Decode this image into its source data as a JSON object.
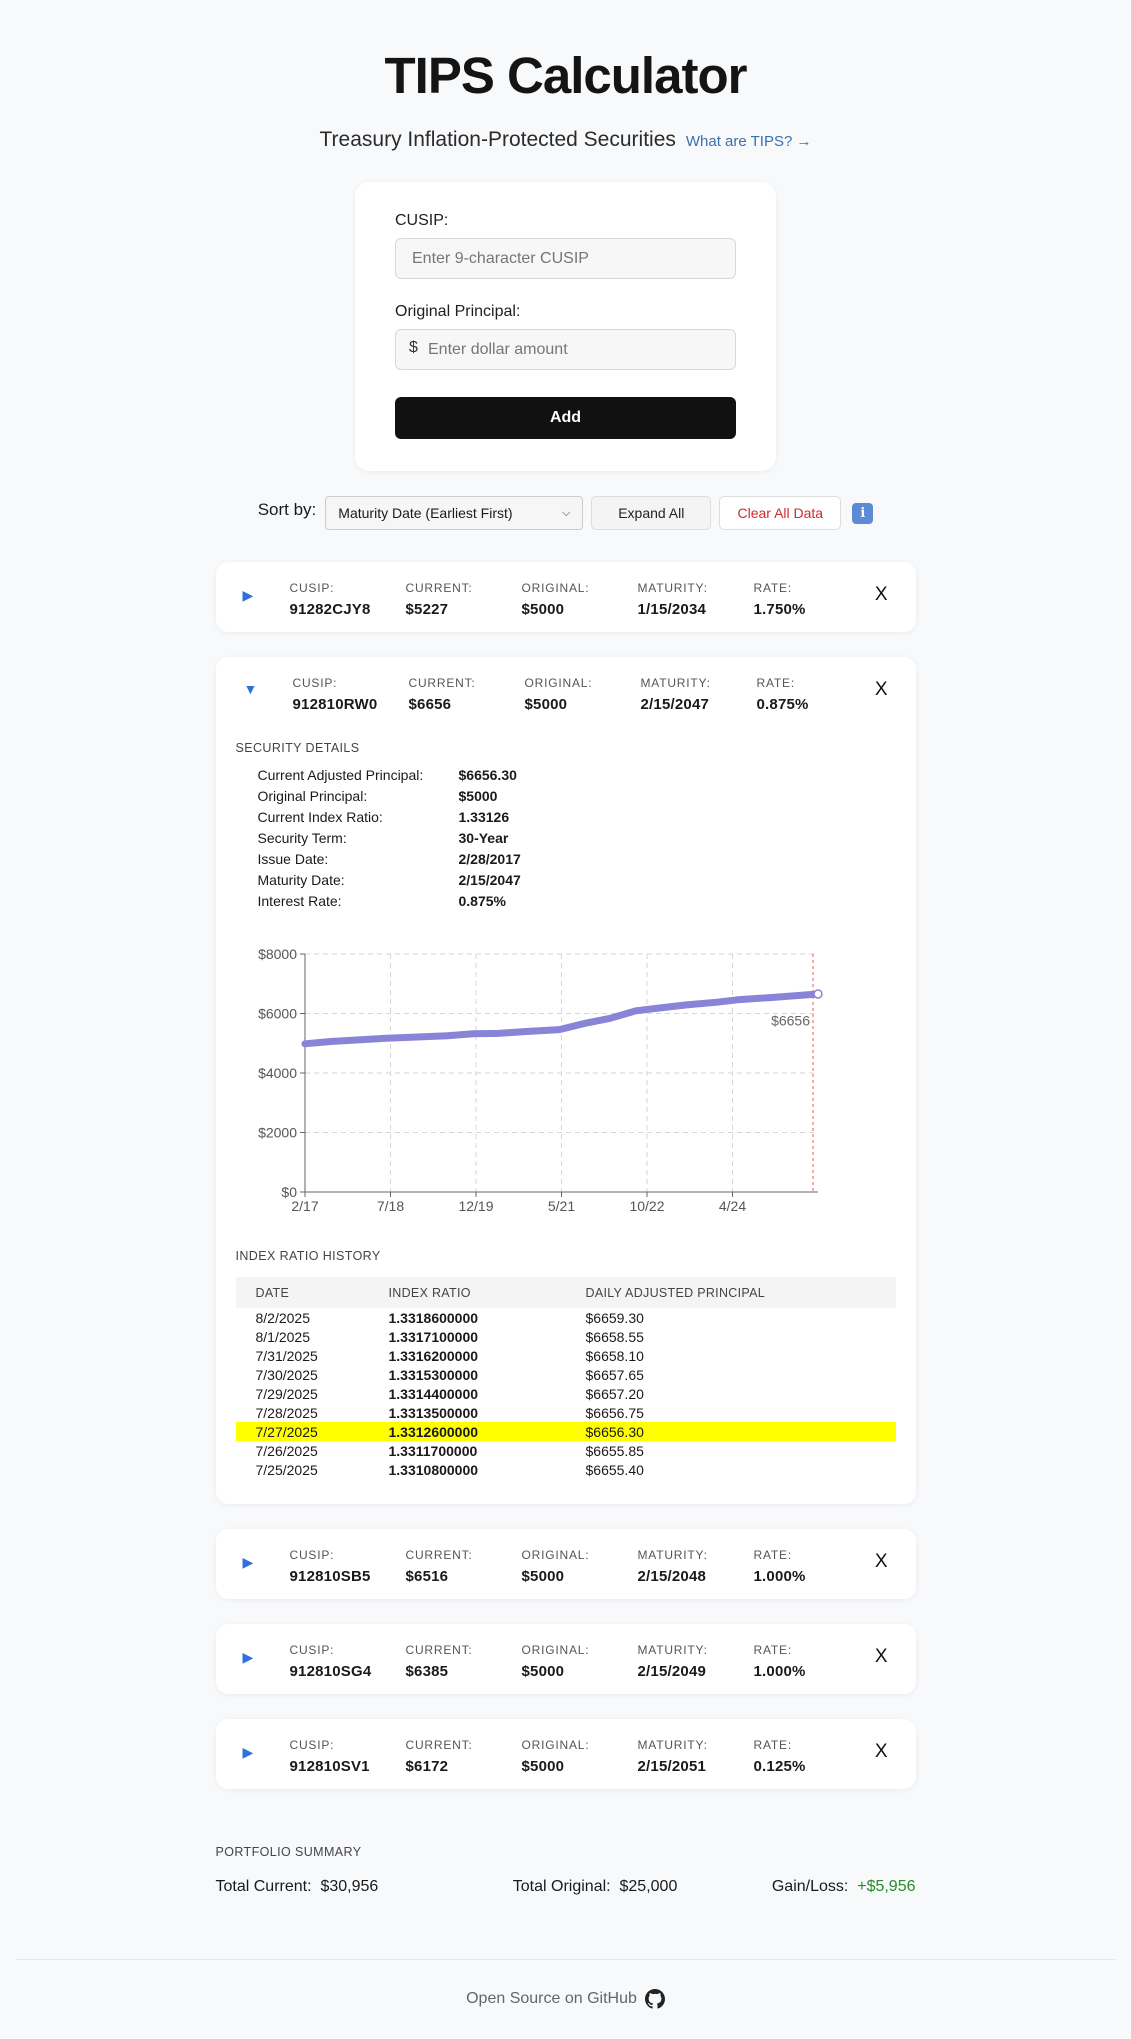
{
  "header": {
    "title": "TIPS Calculator",
    "subtitle": "Treasury Inflation-Protected Securities",
    "what_link": "What are TIPS? →"
  },
  "form": {
    "cusip_label": "CUSIP:",
    "cusip_placeholder": "Enter 9-character CUSIP",
    "principal_label": "Original Principal:",
    "currency_symbol": "$",
    "principal_placeholder": "Enter dollar amount",
    "add_label": "Add"
  },
  "controls": {
    "sort_label": "Sort by:",
    "sort_value": "Maturity Date (Earliest First)",
    "expand_label": "Expand All",
    "clear_label": "Clear All Data",
    "info_icon": "info-icon"
  },
  "field_labels": {
    "cusip": "CUSIP:",
    "current": "CURRENT:",
    "original": "ORIGINAL:",
    "maturity": "MATURITY:",
    "rate": "RATE:"
  },
  "close_label": "X",
  "securities": [
    {
      "cusip": "91282CJY8",
      "current": "$5227",
      "original": "$5000",
      "maturity": "1/15/2034",
      "rate": "1.750%",
      "expanded": false
    },
    {
      "cusip": "912810RW0",
      "current": "$6656",
      "original": "$5000",
      "maturity": "2/15/2047",
      "rate": "0.875%",
      "expanded": true
    },
    {
      "cusip": "912810SB5",
      "current": "$6516",
      "original": "$5000",
      "maturity": "2/15/2048",
      "rate": "1.000%",
      "expanded": false
    },
    {
      "cusip": "912810SG4",
      "current": "$6385",
      "original": "$5000",
      "maturity": "2/15/2049",
      "rate": "1.000%",
      "expanded": false
    },
    {
      "cusip": "912810SV1",
      "current": "$6172",
      "original": "$5000",
      "maturity": "2/15/2051",
      "rate": "0.125%",
      "expanded": false
    }
  ],
  "details": {
    "section_title": "SECURITY DETAILS",
    "rows": [
      {
        "label": "Current Adjusted Principal:",
        "value": "$6656.30"
      },
      {
        "label": "Original Principal:",
        "value": "$5000"
      },
      {
        "label": "Current Index Ratio:",
        "value": "1.33126"
      },
      {
        "label": "Security Term:",
        "value": "30-Year"
      },
      {
        "label": "Issue Date:",
        "value": "2/28/2017"
      },
      {
        "label": "Maturity Date:",
        "value": "2/15/2047"
      },
      {
        "label": "Interest Rate:",
        "value": "0.875%"
      }
    ]
  },
  "chart_data": {
    "type": "line",
    "title": "",
    "xlabel": "",
    "ylabel": "",
    "x_ticks": [
      "2/17",
      "7/18",
      "12/19",
      "5/21",
      "10/22",
      "4/24"
    ],
    "y_ticks": [
      "$0",
      "$2000",
      "$4000",
      "$6000",
      "$8000"
    ],
    "ylim": [
      0,
      8000
    ],
    "xlim": [
      "2017-02-28",
      "2025-07-27"
    ],
    "grid": true,
    "line_color": "#8884d8",
    "current_label": "$6656",
    "series": [
      {
        "x": [
          "2017-02-28",
          "2017-08-01",
          "2018-01-01",
          "2018-07-01",
          "2019-01-01",
          "2019-07-01",
          "2019-12-01",
          "2020-05-01",
          "2020-10-01",
          "2021-05-01",
          "2021-10-01",
          "2022-03-01",
          "2022-08-01",
          "2022-12-01",
          "2023-06-01",
          "2023-12-01",
          "2024-04-01",
          "2024-10-01",
          "2025-03-01",
          "2025-07-27"
        ],
        "y": [
          4980,
          5060,
          5110,
          5170,
          5210,
          5250,
          5320,
          5330,
          5390,
          5460,
          5670,
          5840,
          6090,
          6170,
          6290,
          6380,
          6460,
          6530,
          6590,
          6656
        ]
      }
    ]
  },
  "history": {
    "section_title": "INDEX RATIO HISTORY",
    "headers": [
      "DATE",
      "INDEX RATIO",
      "DAILY ADJUSTED PRINCIPAL"
    ],
    "rows": [
      {
        "date": "8/2/2025",
        "ratio": "1.3318600000",
        "principal": "$6659.30",
        "highlight": false
      },
      {
        "date": "8/1/2025",
        "ratio": "1.3317100000",
        "principal": "$6658.55",
        "highlight": false
      },
      {
        "date": "7/31/2025",
        "ratio": "1.3316200000",
        "principal": "$6658.10",
        "highlight": false
      },
      {
        "date": "7/30/2025",
        "ratio": "1.3315300000",
        "principal": "$6657.65",
        "highlight": false
      },
      {
        "date": "7/29/2025",
        "ratio": "1.3314400000",
        "principal": "$6657.20",
        "highlight": false
      },
      {
        "date": "7/28/2025",
        "ratio": "1.3313500000",
        "principal": "$6656.75",
        "highlight": false
      },
      {
        "date": "7/27/2025",
        "ratio": "1.3312600000",
        "principal": "$6656.30",
        "highlight": true
      },
      {
        "date": "7/26/2025",
        "ratio": "1.3311700000",
        "principal": "$6655.85",
        "highlight": false
      },
      {
        "date": "7/25/2025",
        "ratio": "1.3310800000",
        "principal": "$6655.40",
        "highlight": false
      }
    ],
    "highlight_color": "#ffff00"
  },
  "summary": {
    "section_title": "PORTFOLIO SUMMARY",
    "total_current_label": "Total Current:",
    "total_current": "$30,956",
    "total_original_label": "Total Original:",
    "total_original": "$25,000",
    "gain_label": "Gain/Loss:",
    "gain_value": "+$5,956",
    "gain_color": "#2a8a2a"
  },
  "footer": {
    "text": "Open Source on GitHub",
    "icon": "github-icon"
  }
}
